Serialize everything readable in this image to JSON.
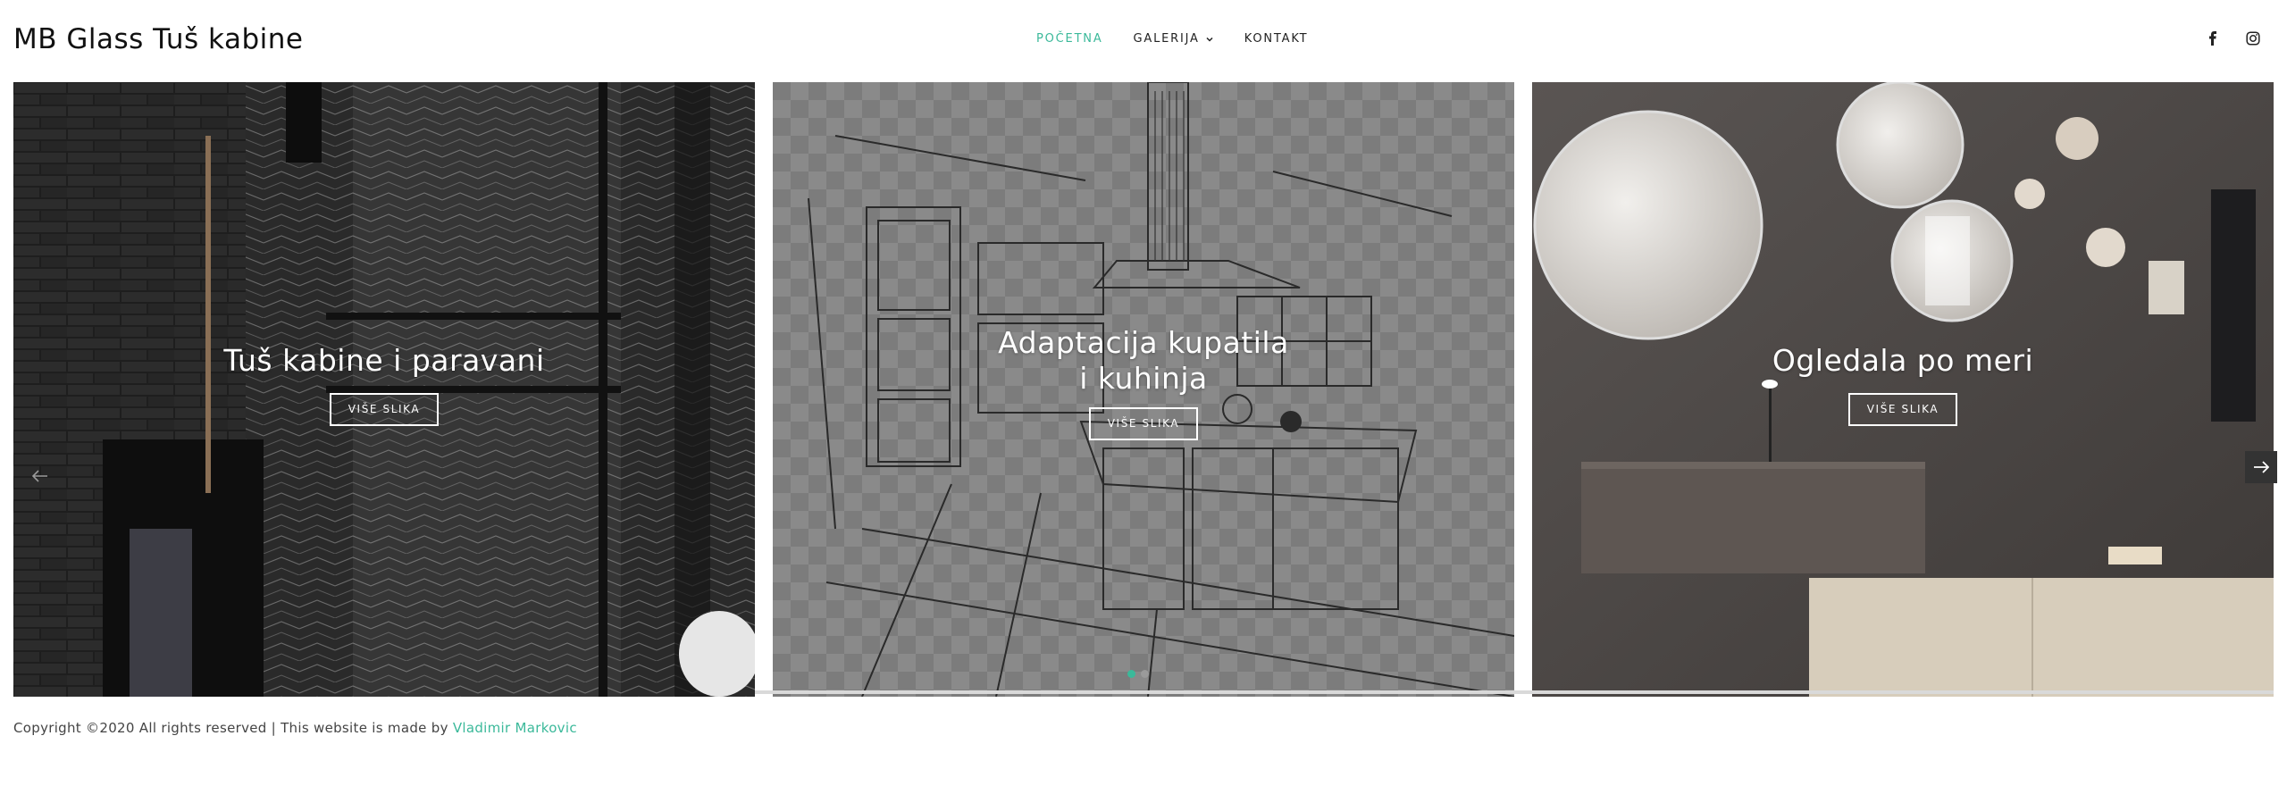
{
  "header": {
    "brand": "MB Glass Tuš kabine",
    "nav": [
      {
        "label": "POČETNA",
        "active": true
      },
      {
        "label": "GALERIJA",
        "has_dropdown": true
      },
      {
        "label": "KONTAKT"
      }
    ],
    "social": [
      {
        "icon": "facebook-icon"
      },
      {
        "icon": "instagram-icon"
      }
    ]
  },
  "slider": {
    "slides": [
      {
        "title": "Tuš kabine i paravani",
        "button": "VIŠE SLIKA"
      },
      {
        "title": "Adaptacija kupatila i kuhinja",
        "button": "VIŠE SLIKA"
      },
      {
        "title": "Ogledala po meri",
        "button": "VIŠE SLIKA"
      }
    ],
    "prev_icon": "arrow-left-icon",
    "next_icon": "arrow-right-icon",
    "dots": 2,
    "active_dot": 0
  },
  "footer": {
    "text": "Copyright ©2020 All rights reserved | This website is made by ",
    "author": "Vladimir Markovic"
  },
  "colors": {
    "accent": "#3bb99a",
    "text": "#111111"
  }
}
